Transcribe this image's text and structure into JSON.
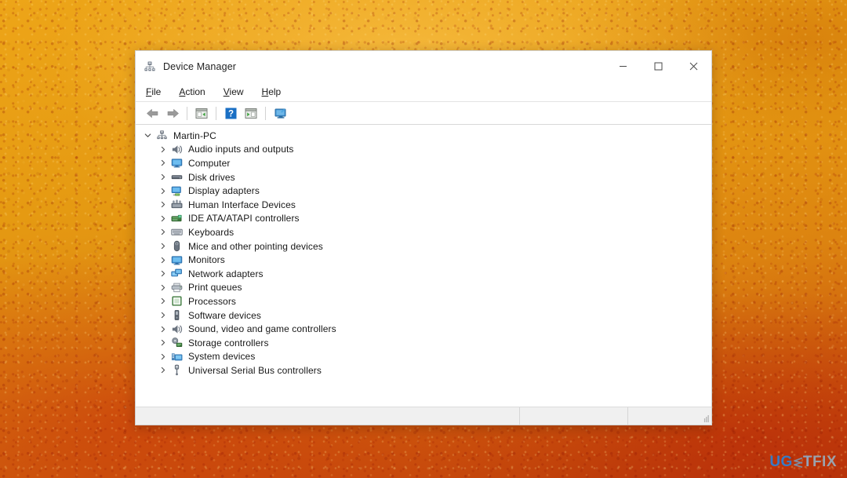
{
  "desktop": {
    "background_color": "#e8a116",
    "watermark": {
      "part1": "UG",
      "mark": "logo-chevron-mark",
      "part2": "T",
      "part3": "FIX"
    }
  },
  "window": {
    "title": "Device Manager",
    "icon": "device-manager-icon",
    "controls": {
      "minimize": "–",
      "maximize": "□",
      "close": "✕"
    },
    "menu": [
      {
        "label": "File",
        "accel": "F",
        "rest": "ile"
      },
      {
        "label": "Action",
        "accel": "A",
        "rest": "ction"
      },
      {
        "label": "View",
        "accel": "V",
        "rest": "iew"
      },
      {
        "label": "Help",
        "accel": "H",
        "rest": "elp"
      }
    ],
    "toolbar": [
      {
        "name": "back-button",
        "icon": "arrow-left-icon",
        "type": "button"
      },
      {
        "name": "forward-button",
        "icon": "arrow-right-icon",
        "type": "button"
      },
      {
        "name": "toolbar-separator-1",
        "icon": "separator",
        "type": "separator"
      },
      {
        "name": "show-hide-console-tree-button",
        "icon": "console-tree-icon",
        "type": "button"
      },
      {
        "name": "toolbar-separator-2",
        "icon": "separator",
        "type": "separator"
      },
      {
        "name": "help-button",
        "icon": "help-question-icon",
        "type": "button"
      },
      {
        "name": "properties-button",
        "icon": "properties-panel-icon",
        "type": "button"
      },
      {
        "name": "toolbar-separator-3",
        "icon": "separator",
        "type": "separator"
      },
      {
        "name": "scan-hardware-changes-button",
        "icon": "monitor-scan-icon",
        "type": "button"
      }
    ],
    "tree": {
      "root": {
        "label": "Martin-PC",
        "icon": "computer-root-icon",
        "expanded": true,
        "chevron": "⌄"
      },
      "chevron_collapsed": "›",
      "items": [
        {
          "label": "Audio inputs and outputs",
          "icon": "speaker-icon"
        },
        {
          "label": "Computer",
          "icon": "monitor-icon"
        },
        {
          "label": "Disk drives",
          "icon": "hard-disk-icon"
        },
        {
          "label": "Display adapters",
          "icon": "display-adapter-icon"
        },
        {
          "label": "Human Interface Devices",
          "icon": "hid-icon"
        },
        {
          "label": "IDE ATA/ATAPI controllers",
          "icon": "ide-controller-icon"
        },
        {
          "label": "Keyboards",
          "icon": "keyboard-icon"
        },
        {
          "label": "Mice and other pointing devices",
          "icon": "mouse-icon"
        },
        {
          "label": "Monitors",
          "icon": "monitor-icon"
        },
        {
          "label": "Network adapters",
          "icon": "network-adapter-icon"
        },
        {
          "label": "Print queues",
          "icon": "printer-icon"
        },
        {
          "label": "Processors",
          "icon": "processor-icon"
        },
        {
          "label": "Software devices",
          "icon": "software-device-icon"
        },
        {
          "label": "Sound, video and game controllers",
          "icon": "speaker-icon"
        },
        {
          "label": "Storage controllers",
          "icon": "storage-controller-icon"
        },
        {
          "label": "System devices",
          "icon": "system-device-icon"
        },
        {
          "label": "Universal Serial Bus controllers",
          "icon": "usb-icon"
        }
      ]
    },
    "statusbar": {
      "pane1": "",
      "pane2": "",
      "pane3": ""
    }
  }
}
